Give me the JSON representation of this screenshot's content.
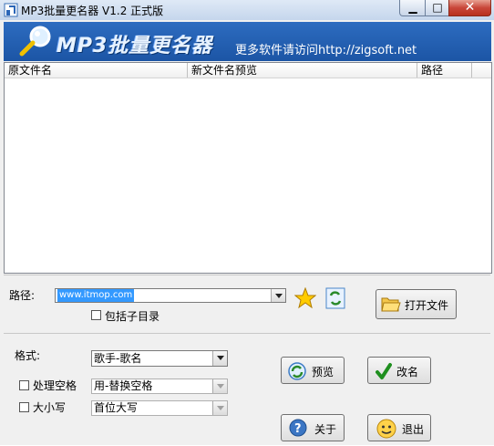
{
  "window": {
    "title": "MP3批量更名器 V1.2 正式版",
    "close_glyph": "✕",
    "min_glyph": "▁",
    "max_glyph": "□"
  },
  "banner": {
    "title": "MP3批量更名器",
    "link_text": "更多软件请访问http://zigsoft.net"
  },
  "list": {
    "columns": [
      "原文件名",
      "新文件名预览",
      "路径"
    ],
    "rows": []
  },
  "path": {
    "label": "路径:",
    "value": "www.itmop.com",
    "include_subdirs_label": "包括子目录",
    "include_subdirs_checked": false,
    "open_button_label": "打开文件"
  },
  "options": {
    "format_label": "格式:",
    "format_value": "歌手-歌名",
    "space_label": "处理空格",
    "space_checked": false,
    "space_value": "用-替换空格",
    "case_label": "大小写",
    "case_checked": false,
    "case_value": "首位大写"
  },
  "actions": {
    "preview_label": "预览",
    "rename_label": "改名",
    "about_label": "关于",
    "exit_label": "退出"
  },
  "colors": {
    "banner": "#1c55a5",
    "accent": "#2d6cc0"
  },
  "icons": [
    "app-icon",
    "magnifier-logo-icon",
    "favorite-star-icon",
    "refresh-icon",
    "open-folder-icon",
    "preview-icon",
    "checkmark-icon",
    "about-icon",
    "exit-face-icon"
  ]
}
